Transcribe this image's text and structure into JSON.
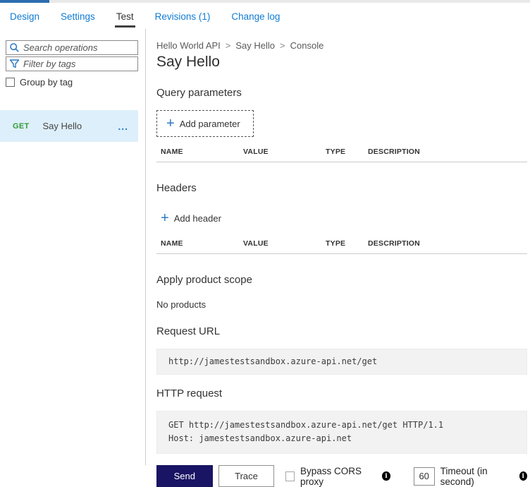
{
  "colors": {
    "accent_blue": "#0f7cd4",
    "get_method_green": "#349a38",
    "send_button_bg": "#191464",
    "selected_row_bg": "#ddeffa",
    "top_strip_accent": "#2c6daf"
  },
  "tabs": {
    "items": [
      "Design",
      "Settings",
      "Test",
      "Revisions (1)",
      "Change log"
    ],
    "active": "Test"
  },
  "sidebar": {
    "search_placeholder": "Search operations",
    "filter_placeholder": "Filter by tags",
    "group_by_tag_label": "Group by tag",
    "operation": {
      "method": "GET",
      "name": "Say Hello",
      "more": "..."
    }
  },
  "breadcrumb": {
    "items": [
      "Hello World API",
      "Say Hello",
      "Console"
    ],
    "separator": ">"
  },
  "main": {
    "title": "Say Hello",
    "query_parameters": {
      "heading": "Query parameters",
      "plus": "+",
      "add_label": "Add parameter",
      "columns": [
        "NAME",
        "VALUE",
        "TYPE",
        "DESCRIPTION"
      ]
    },
    "headers_section": {
      "heading": "Headers",
      "plus": "+",
      "add_label": "Add header",
      "columns": [
        "NAME",
        "VALUE",
        "TYPE",
        "DESCRIPTION"
      ]
    },
    "product_scope": {
      "heading": "Apply product scope",
      "empty_text": "No products"
    },
    "request_url": {
      "heading": "Request URL",
      "url": "http://jamestestsandbox.azure-api.net/get"
    },
    "http_request": {
      "heading": "HTTP request",
      "lines": [
        "GET http://jamestestsandbox.azure-api.net/get HTTP/1.1",
        "Host: jamestestsandbox.azure-api.net"
      ]
    },
    "actions": {
      "send": "Send",
      "trace": "Trace",
      "bypass_label": "Bypass CORS proxy",
      "timeout_value": "60",
      "timeout_label": "Timeout (in second)",
      "info_glyph": "i"
    }
  }
}
